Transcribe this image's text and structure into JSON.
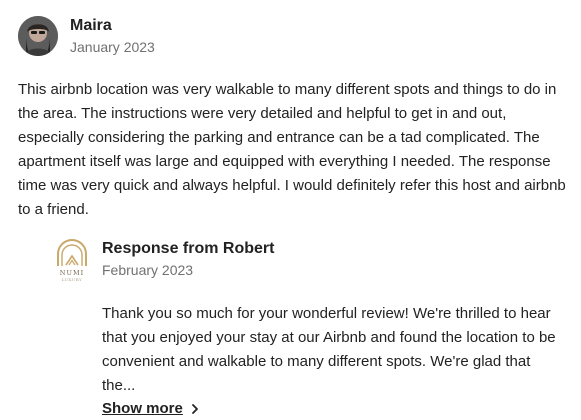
{
  "review": {
    "reviewer_name": "Maira",
    "date": "January 2023",
    "text": "This airbnb location was very walkable to many different spots and things to do in the area. The instructions were very detailed and helpful to get in and out, especially considering the parking and entrance can be a tad complicated. The apartment itself was large and equipped with everything I needed. The response time was very quick and always helpful. I would definitely refer this host and airbnb to a friend."
  },
  "response": {
    "title": "Response from Robert",
    "date": "February 2023",
    "logo_word": "NUMI",
    "logo_sub": "LUXURY",
    "text": "Thank you so much for your wonderful review! We're thrilled to hear that you enjoyed your stay at our Airbnb and found the location to be convenient and walkable to many different spots. We're glad that the...",
    "show_more_label": "Show more"
  },
  "icons": {
    "show_more": "chevron-right-icon"
  },
  "colors": {
    "text_primary": "#222222",
    "text_secondary": "#717171",
    "logo_gold": "#c9a86a"
  }
}
